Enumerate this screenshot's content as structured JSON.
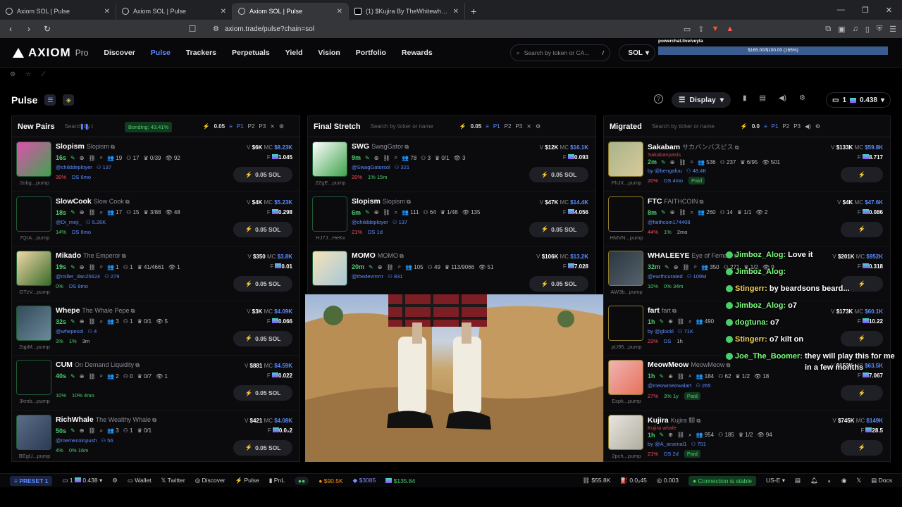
{
  "browser": {
    "tabs": [
      {
        "label": "Axiom SOL | Pulse"
      },
      {
        "label": "Axiom SOL | Pulse"
      },
      {
        "label": "Axiom SOL | Pulse"
      },
      {
        "label": "(1) $Kujira By TheWhitewhalev2.Com"
      }
    ],
    "url": "axiom.trade/pulse?chain=sol"
  },
  "header": {
    "logo": "AXIOM",
    "logo_suffix": "Pro",
    "nav": [
      "Discover",
      "Pulse",
      "Trackers",
      "Perpetuals",
      "Yield",
      "Vision",
      "Portfolio",
      "Rewards"
    ],
    "search_placeholder": "Search by token or CA...",
    "search_shortcut": "/",
    "chain": "SOL",
    "overlay_url": "powerchat.live/veyta",
    "overlay_progress": "$165.00/$100.00 (165%)"
  },
  "pulse": {
    "title": "Pulse",
    "display_label": "Display",
    "wallet_count": "1",
    "wallet_balance": "0.438"
  },
  "columns": [
    {
      "title": "New Pairs",
      "search_placeholder": "Search by t",
      "bonding": "Bonding: 43.41%",
      "amount": "0.05",
      "presets": [
        "P1",
        "P2",
        "P3"
      ],
      "rows": [
        {
          "name": "Slopism",
          "sub": "Slopism",
          "age": "16s",
          "stats": [
            "19",
            "17",
            "0/39",
            "92"
          ],
          "dev": "@childdeployer",
          "holders": "137",
          "ticker": "2obg...pump",
          "pcts": [
            "30%",
            "DS 6mo"
          ],
          "v": "$6K",
          "mc": "$8.23K",
          "f": "1.045",
          "buy": "0.05 SOL"
        },
        {
          "name": "SlowCook",
          "sub": "Slow Cook",
          "age": "18s",
          "stats": [
            "17",
            "15",
            "3/88",
            "48"
          ],
          "dev": "@Di_meji_",
          "holders": "5.26K",
          "ticker": "7QrA...pump",
          "pcts": [
            "14%",
            "DS 6mo"
          ],
          "v": "$4K",
          "mc": "$5.23K",
          "f": "0.298",
          "buy": "0.05 SOL"
        },
        {
          "name": "Mikado",
          "sub": "The Emperor",
          "age": "19s",
          "stats": [
            "1",
            "1",
            "41/4661",
            "1"
          ],
          "dev": "@miller_dan25624",
          "holders": "279",
          "ticker": "GTzV...pump",
          "pcts": [
            "0%",
            "DS 8mo"
          ],
          "v": "$350",
          "mc": "$3.8K",
          "f": "0.01",
          "buy": "0.05 SOL"
        },
        {
          "name": "Whepe",
          "sub": "The Whale Pepe",
          "age": "32s",
          "stats": [
            "3",
            "1",
            "0/1",
            "5"
          ],
          "dev": "@whepesol",
          "holders": "4",
          "ticker": "2qpM...pump",
          "pcts": [
            "3%",
            "1%",
            "3m"
          ],
          "v": "$3K",
          "mc": "$4.09K",
          "f": "0.066",
          "buy": "0.05 SOL"
        },
        {
          "name": "CUM",
          "sub": "On Demand Liquidity",
          "age": "40s",
          "stats": [
            "2",
            "0",
            "0/7",
            "1"
          ],
          "dev": "",
          "holders": "",
          "ticker": "3kmb...pump",
          "pcts": [
            "10%",
            "10% 4mo"
          ],
          "v": "$881",
          "mc": "$4.59K",
          "f": "0.022",
          "buy": "0.05 SOL"
        },
        {
          "name": "RichWhale",
          "sub": "The Wealthy Whale",
          "age": "50s",
          "stats": [
            "3",
            "1",
            "0/1",
            ""
          ],
          "dev": "@memecoinpush",
          "holders": "56",
          "ticker": "BEgU...pump",
          "pcts": [
            "4%",
            "0% 16m"
          ],
          "v": "$421",
          "mc": "$4.08K",
          "f": "0.0₂2",
          "buy": "0.05 SOL"
        }
      ]
    },
    {
      "title": "Final Stretch",
      "search_placeholder": "Search by ticker or name",
      "amount": "0.05",
      "presets": [
        "P1",
        "P2",
        "P3"
      ],
      "rows": [
        {
          "name": "SWG",
          "sub": "SwagGator",
          "age": "9m",
          "stats": [
            "78",
            "3",
            "0/1",
            "3"
          ],
          "dev": "@SwagGatorsol",
          "holders": "321",
          "ticker": "2ZgE...pump",
          "pcts": [
            "20%",
            "1% 15m"
          ],
          "v": "$12K",
          "mc": "$16.1K",
          "f": "0.093",
          "buy": "0.05 SOL"
        },
        {
          "name": "Slopism",
          "sub": "Slopism",
          "age": "6m",
          "stats": [
            "111",
            "64",
            "1/48",
            "135"
          ],
          "dev": "@childdeployer",
          "holders": "137",
          "ticker": "HJ7J...HeKx",
          "pcts": [
            "21%",
            "DS 1d"
          ],
          "v": "$47K",
          "mc": "$14.4K",
          "f": "4.056",
          "buy": "0.05 SOL"
        },
        {
          "name": "MOMO",
          "sub": "MOMO",
          "age": "20m",
          "stats": [
            "105",
            "49",
            "113/9066",
            "51"
          ],
          "dev": "@thedevrrrrrr",
          "holders": "831",
          "ticker": "",
          "pcts": [],
          "v": "$106K",
          "mc": "$13.2K",
          "f": "7.028",
          "buy": "0.05 SOL"
        }
      ]
    },
    {
      "title": "Migrated",
      "search_placeholder": "Search by ticker or name",
      "amount": "0.0",
      "presets": [
        "P1",
        "P2",
        "P3"
      ],
      "rows": [
        {
          "name": "Sakabam",
          "sub": "サカバンバスピス",
          "sub2": "Sakabanpasis",
          "age": "2m",
          "stats": [
            "536",
            "237",
            "6/95",
            "501"
          ],
          "dev": "by @bengafuu",
          "holders": "48.4K",
          "ticker": "FhJX...pump",
          "pcts": [
            "20%",
            "DS 4mo",
            "Paid"
          ],
          "v": "$133K",
          "mc": "$59.8K",
          "f": "8.717"
        },
        {
          "name": "FTC",
          "sub": "FAITHCOIN",
          "age": "8m",
          "stats": [
            "260",
            "14",
            "1/1",
            "2"
          ],
          "dev": "@faithcoin174408",
          "holders": "",
          "ticker": "HMVN...pump",
          "pcts": [
            "44%",
            "1%",
            "2mo"
          ],
          "v": "$4K",
          "mc": "$47.6K",
          "f": "0.086"
        },
        {
          "name": "WHALEEYE",
          "sub": "Eye of Female",
          "age": "32m",
          "stats": [
            "350",
            "271",
            "1/2",
            "9"
          ],
          "dev": "@earthcurated",
          "holders": "109M",
          "ticker": "AW3b...pump",
          "pcts": [
            "10%",
            "0% 34m"
          ],
          "v": "$201K",
          "mc": "$952K",
          "f": "0.318"
        },
        {
          "name": "fart",
          "sub": "fart",
          "age": "1h",
          "stats": [
            "490",
            "",
            "",
            ""
          ],
          "dev": "by @glockl",
          "holders": "71K",
          "ticker": "pU95...pump",
          "pcts": [
            "23%",
            "DS",
            "1h"
          ],
          "v": "$173K",
          "mc": "$60.1K",
          "f": "10.22"
        },
        {
          "name": "MeowMeow",
          "sub": "MeowMeow",
          "age": "1h",
          "stats": [
            "184",
            "62",
            "1/2",
            "18"
          ],
          "dev": "@meowmeowalart",
          "holders": "265",
          "ticker": "Espk...pump",
          "pcts": [
            "27%",
            "3% 1y",
            "Paid"
          ],
          "v": "$153K",
          "mc": "$63.5K",
          "f": "7.067"
        },
        {
          "name": "Kujira",
          "sub": "Kujira 鯨",
          "sub2": "Kujira whale",
          "age": "1h",
          "stats": [
            "954",
            "185",
            "1/2",
            "94"
          ],
          "dev": "by @A_arsenal1",
          "holders": "701",
          "ticker": "2pch...pump",
          "pcts": [
            "21%",
            "DS 2d",
            "Paid"
          ],
          "v": "$745K",
          "mc": "$149K",
          "f": "28.5"
        }
      ]
    }
  ],
  "chat": [
    {
      "user": "Jimboz_Alog:",
      "msg": "Love it",
      "color": "#7dff7d"
    },
    {
      "user": "Jimboz_Alog:",
      "msg": "",
      "color": "#7dff7d"
    },
    {
      "user": "Stingerr:",
      "msg": "by beardsons beard...",
      "color": "#f4d35e"
    },
    {
      "user": "Jimboz_Alog:",
      "msg": "o7",
      "color": "#7dff7d"
    },
    {
      "user": "dogtuna:",
      "msg": "o7",
      "color": "#7dff7d"
    },
    {
      "user": "Stingerr:",
      "msg": "o7 kilt on",
      "color": "#f4d35e"
    },
    {
      "user": "Joe_The_Boomer:",
      "msg": "they will play this for me in a few months",
      "color": "#7dff7d"
    }
  ],
  "footer": {
    "preset": "PRESET 1",
    "wallets": "1",
    "balance": "0.438",
    "items": [
      "Wallet",
      "Twitter",
      "Discover",
      "Pulse",
      "PnL"
    ],
    "btc": "$90.5K",
    "eth": "$3085",
    "sol": "$135.84",
    "stat1": "$55.8K",
    "stat2": "0.0₂45",
    "stat3": "0.003",
    "connection": "Connection is stable",
    "region": "US-E",
    "docs": "Docs"
  }
}
